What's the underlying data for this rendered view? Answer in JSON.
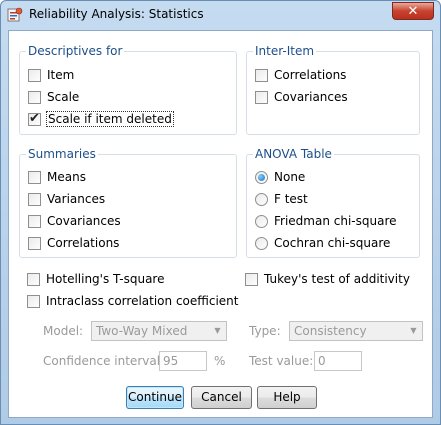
{
  "window": {
    "title": "Reliability Analysis: Statistics",
    "close_glyph": "✕"
  },
  "descriptives": {
    "title": "Descriptives for",
    "items": [
      {
        "label": "Item",
        "accel": "I",
        "rest": "tem",
        "checked": false
      },
      {
        "label": "Scale",
        "accel": "S",
        "rest": "cale",
        "checked": false
      },
      {
        "label": "Scale if item deleted",
        "accel": "A",
        "checked": true
      }
    ]
  },
  "inter_item": {
    "title": "Inter-Item",
    "items": [
      {
        "label": "Correlations",
        "accel": "l",
        "checked": false
      },
      {
        "label": "Covariances",
        "accel": "n",
        "checked": false
      }
    ]
  },
  "summaries": {
    "title": "Summaries",
    "items": [
      {
        "label": "Means",
        "checked": false
      },
      {
        "label": "Variances",
        "checked": false
      },
      {
        "label": "Covariances",
        "checked": false
      },
      {
        "label": "Correlations",
        "checked": false
      }
    ]
  },
  "anova": {
    "title": "ANOVA Table",
    "items": [
      {
        "label": "None",
        "selected": true
      },
      {
        "label": "F test",
        "selected": false
      },
      {
        "label": "Friedman chi-square",
        "selected": false
      },
      {
        "label": "Cochran chi-square",
        "selected": false
      }
    ]
  },
  "options": {
    "hotelling": {
      "label": "Hotelling's T-square",
      "checked": false
    },
    "tukey": {
      "label": "Tukey's test of additivity",
      "checked": false
    },
    "icc": {
      "label": "Intraclass correlation coefficient",
      "checked": false
    }
  },
  "icc_fields": {
    "model_label": "Model:",
    "model_value": "Two-Way Mixed",
    "type_label": "Type:",
    "type_value": "Consistency",
    "ci_label": "Confidence interval:",
    "ci_value": "95",
    "ci_unit": "%",
    "test_label": "Test value:",
    "test_value": "0"
  },
  "buttons": {
    "continue": "Continue",
    "cancel": "Cancel",
    "help": "Help"
  },
  "colors": {
    "group_title": "#1d4f8c",
    "frame": "#b0cbe6",
    "disabled_text": "#9a9a9a"
  },
  "icons": {
    "app": "spss-reliability-icon",
    "close": "close-icon",
    "dropdown": "chevron-down-icon"
  }
}
